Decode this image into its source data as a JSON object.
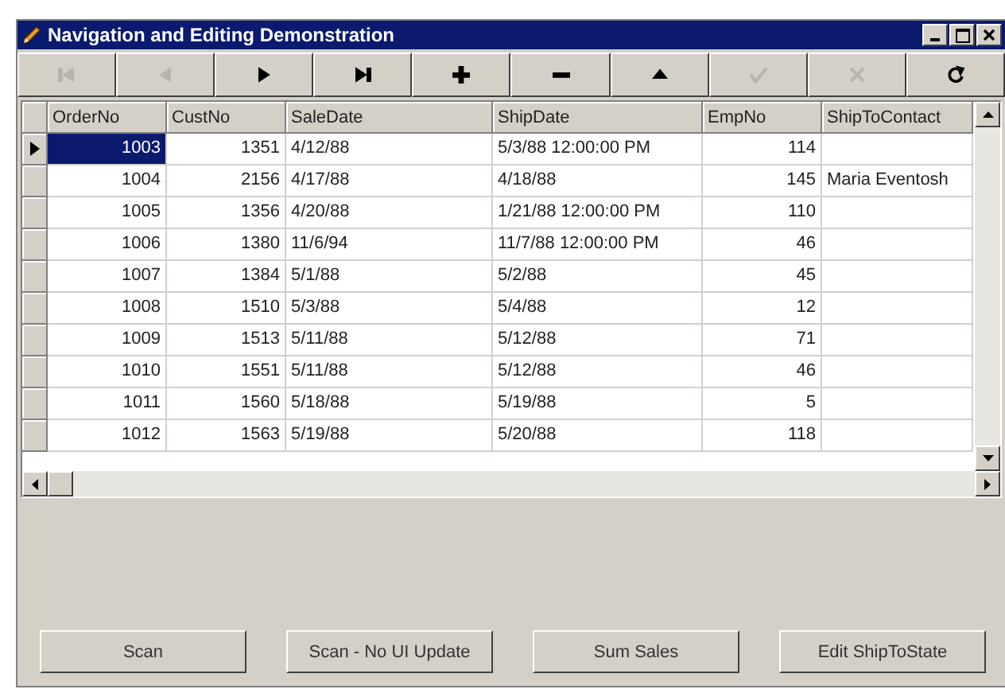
{
  "window": {
    "title": "Navigation and Editing Demonstration"
  },
  "navigator": [
    {
      "kind": "first",
      "disabled": true
    },
    {
      "kind": "prior",
      "disabled": true
    },
    {
      "kind": "next",
      "disabled": false
    },
    {
      "kind": "last",
      "disabled": false
    },
    {
      "kind": "insert",
      "disabled": false
    },
    {
      "kind": "delete",
      "disabled": false
    },
    {
      "kind": "edit",
      "disabled": false
    },
    {
      "kind": "post",
      "disabled": true
    },
    {
      "kind": "cancel",
      "disabled": true
    },
    {
      "kind": "refresh",
      "disabled": false
    }
  ],
  "table": {
    "columns": [
      "OrderNo",
      "CustNo",
      "SaleDate",
      "ShipDate",
      "EmpNo",
      "ShipToContact"
    ],
    "rows": [
      {
        "selected": true,
        "cells": [
          "1003",
          "1351",
          "4/12/88",
          "5/3/88 12:00:00 PM",
          "114",
          ""
        ]
      },
      {
        "selected": false,
        "cells": [
          "1004",
          "2156",
          "4/17/88",
          "4/18/88",
          "145",
          "Maria Eventosh"
        ]
      },
      {
        "selected": false,
        "cells": [
          "1005",
          "1356",
          "4/20/88",
          "1/21/88 12:00:00 PM",
          "110",
          ""
        ]
      },
      {
        "selected": false,
        "cells": [
          "1006",
          "1380",
          "11/6/94",
          "11/7/88 12:00:00 PM",
          "46",
          ""
        ]
      },
      {
        "selected": false,
        "cells": [
          "1007",
          "1384",
          "5/1/88",
          "5/2/88",
          "45",
          ""
        ]
      },
      {
        "selected": false,
        "cells": [
          "1008",
          "1510",
          "5/3/88",
          "5/4/88",
          "12",
          ""
        ]
      },
      {
        "selected": false,
        "cells": [
          "1009",
          "1513",
          "5/11/88",
          "5/12/88",
          "71",
          ""
        ]
      },
      {
        "selected": false,
        "cells": [
          "1010",
          "1551",
          "5/11/88",
          "5/12/88",
          "46",
          ""
        ]
      },
      {
        "selected": false,
        "cells": [
          "1011",
          "1560",
          "5/18/88",
          "5/19/88",
          "5",
          ""
        ]
      },
      {
        "selected": false,
        "cells": [
          "1012",
          "1563",
          "5/19/88",
          "5/20/88",
          "118",
          ""
        ]
      }
    ]
  },
  "buttons": [
    "Scan",
    "Scan - No UI Update",
    "Sum Sales",
    "Edit ShipToState"
  ]
}
